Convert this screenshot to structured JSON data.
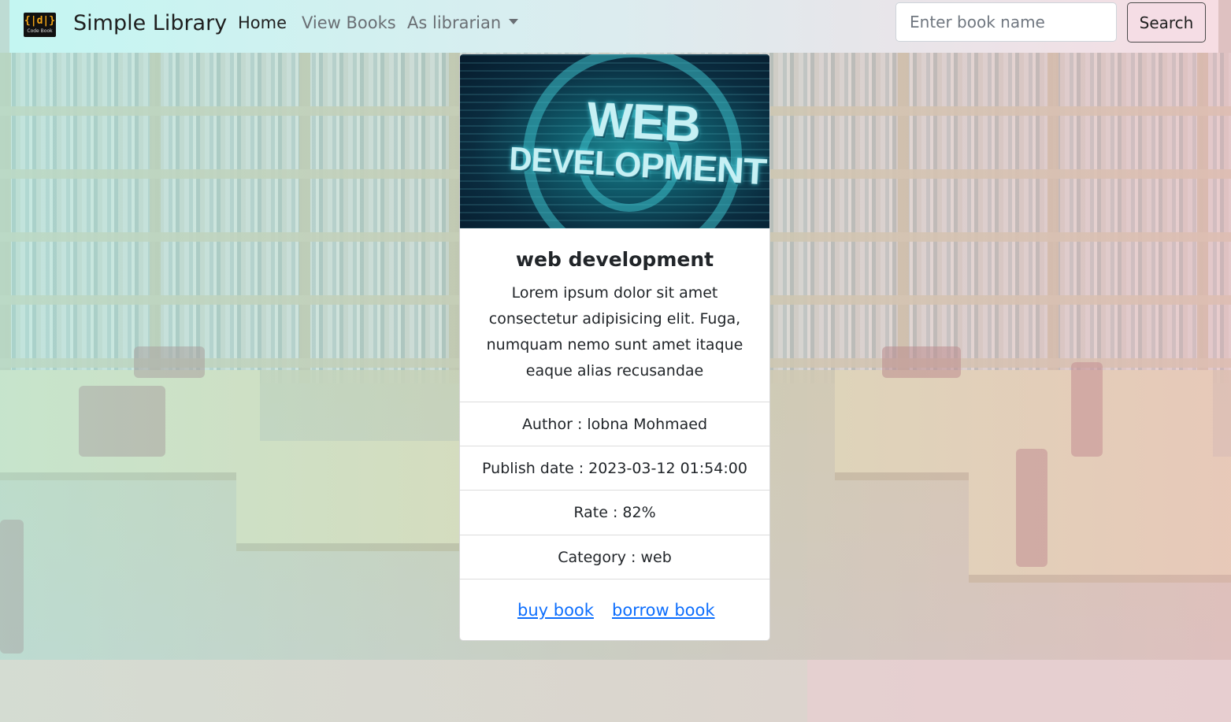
{
  "navbar": {
    "brand": "Simple Library",
    "logo_glyph": "{|d|}",
    "logo_text": "Code Book",
    "links": {
      "home": "Home",
      "view_books": "View Books",
      "as_librarian": "As librarian"
    },
    "search": {
      "placeholder": "Enter book name",
      "value": "",
      "button_label": "Search"
    }
  },
  "book": {
    "image_text_line1": "WEB",
    "image_text_line2": "DEVELOPMENT",
    "title": "web development",
    "description": "Lorem ipsum dolor sit amet consectetur adipisicing elit. Fuga, numquam nemo sunt amet itaque eaque alias recusandae",
    "author": "Author : lobna Mohmaed",
    "publish_date": "Publish date : 2023-03-12 01:54:00",
    "rate": "Rate : 82%",
    "category": "Category : web",
    "buy_label": "buy book",
    "borrow_label": "borrow book"
  },
  "colors": {
    "link": "#0d6efd",
    "navbar_start": "#c4f6f2",
    "navbar_end": "#f6dde3",
    "search_button_bg": "#f5dde5"
  },
  "icons": {
    "dropdown": "chevron-down-icon",
    "logo": "code-book-logo"
  }
}
